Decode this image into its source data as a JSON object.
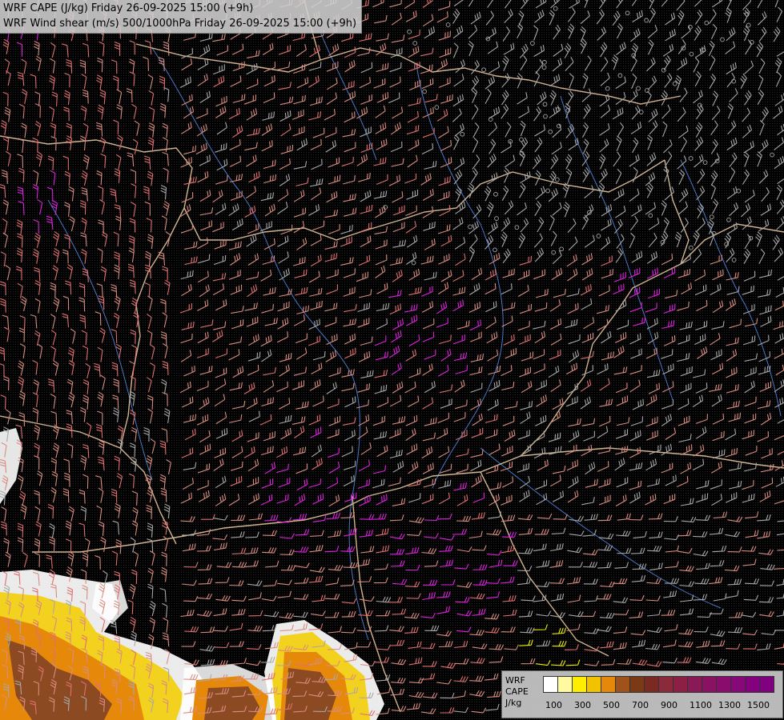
{
  "title": {
    "line1": "WRF CAPE (J/kg) Friday 26-09-2025 15:00 (+9h)",
    "line2": "WRF Wind shear (m/s) 500/1000hPa Friday 26-09-2025 15:00 (+9h)"
  },
  "legend": {
    "label_wrf": "WRF",
    "label_cape": "CAPE",
    "label_unit": "J/kg",
    "colors": [
      "#ffffff",
      "#fffaa0",
      "#ffee00",
      "#f2c200",
      "#e6890b",
      "#a0521b",
      "#7a3a16",
      "#7a2a22",
      "#8a2a3a",
      "#8d1f45",
      "#8a1a55",
      "#8a1262",
      "#8a0c6c",
      "#870878",
      "#85007f",
      "#800080"
    ],
    "ticks": [
      "100",
      "300",
      "500",
      "700",
      "900",
      "1100",
      "1300",
      "1500"
    ]
  },
  "map": {
    "background": "#000000",
    "barb_colors": {
      "weak": "#a8a8a8",
      "moderate": "#d98c80",
      "strong": "#e07070",
      "very_strong": "#e020e0",
      "extreme": "#f0f000"
    },
    "border_color": "#e8c8a0",
    "river_color": "#4a78c8",
    "cape_colors": [
      "#ffffff",
      "#f2d21e",
      "#e6890b",
      "#8c4a22"
    ]
  }
}
